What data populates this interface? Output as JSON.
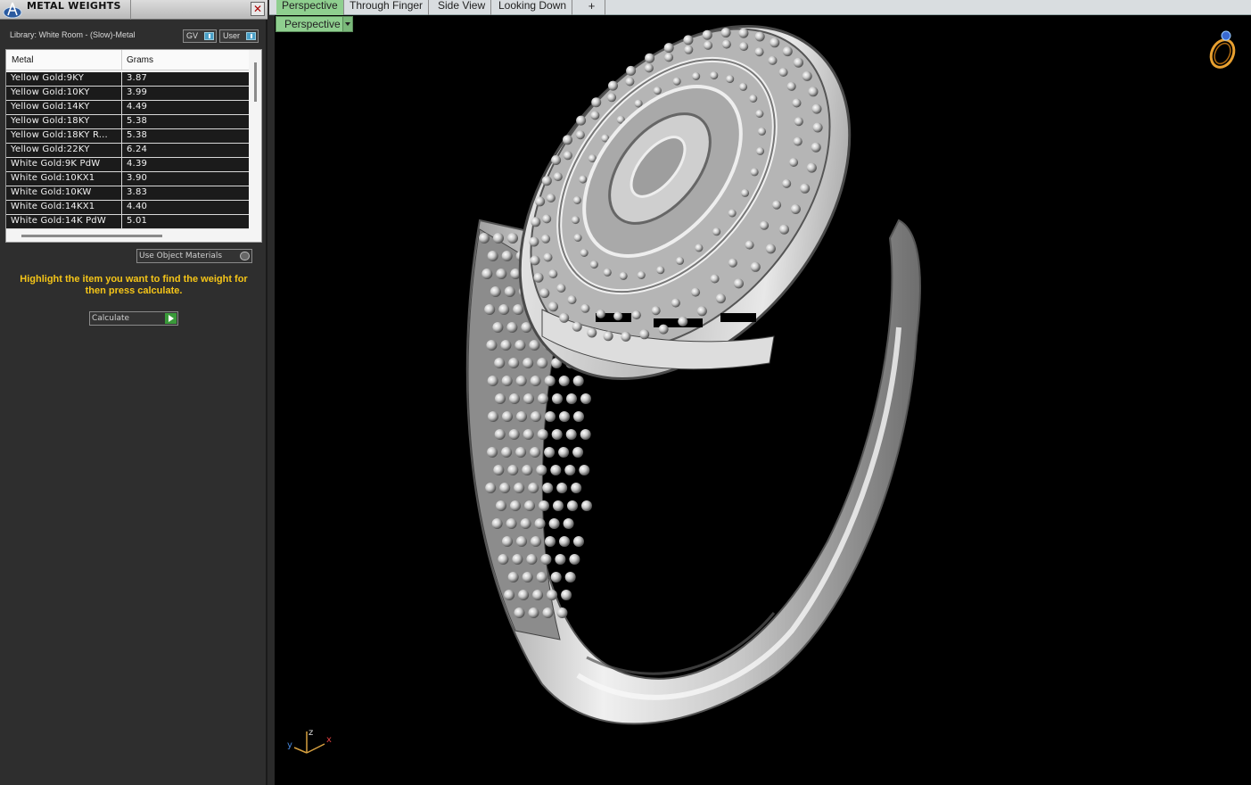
{
  "panel": {
    "title": "METAL WEIGHTS",
    "close_label": "✕",
    "library_label": "Library: White Room - (Slow)-Metal",
    "toggle_gv": "GV",
    "toggle_user": "User",
    "columns": {
      "metal": "Metal",
      "grams": "Grams"
    },
    "rows": [
      {
        "metal": "Yellow Gold:9KY",
        "grams": "3.87"
      },
      {
        "metal": "Yellow Gold:10KY",
        "grams": "3.99"
      },
      {
        "metal": "Yellow Gold:14KY",
        "grams": "4.49"
      },
      {
        "metal": "Yellow Gold:18KY",
        "grams": "5.38"
      },
      {
        "metal": "Yellow Gold:18KY R...",
        "grams": "5.38"
      },
      {
        "metal": "Yellow Gold:22KY",
        "grams": "6.24"
      },
      {
        "metal": "White Gold:9K PdW",
        "grams": "4.39"
      },
      {
        "metal": "White Gold:10KX1",
        "grams": "3.90"
      },
      {
        "metal": "White Gold:10KW",
        "grams": "3.83"
      },
      {
        "metal": "White Gold:14KX1",
        "grams": "4.40"
      },
      {
        "metal": "White Gold:14K PdW",
        "grams": "5.01"
      }
    ],
    "use_object_materials": "Use Object Materials",
    "hint": "Highlight the item you want to find the weight for then press calculate.",
    "calculate_label": "Calculate"
  },
  "view_tabs": [
    "Perspective",
    "Through Finger",
    "Side View",
    "Looking Down",
    "+"
  ],
  "active_tab": "Perspective",
  "view_select": "Perspective",
  "axes": {
    "x": "x",
    "y": "y",
    "z": "z"
  },
  "colors": {
    "hint": "#f5c518",
    "active_tab": "#8fcf8f",
    "viewport_bg": "#000000",
    "metal": "#d6d6d6"
  },
  "icons": {
    "app_logo": "app-logo-icon",
    "corner": "ring-view-icon",
    "calculate": "play-icon"
  }
}
